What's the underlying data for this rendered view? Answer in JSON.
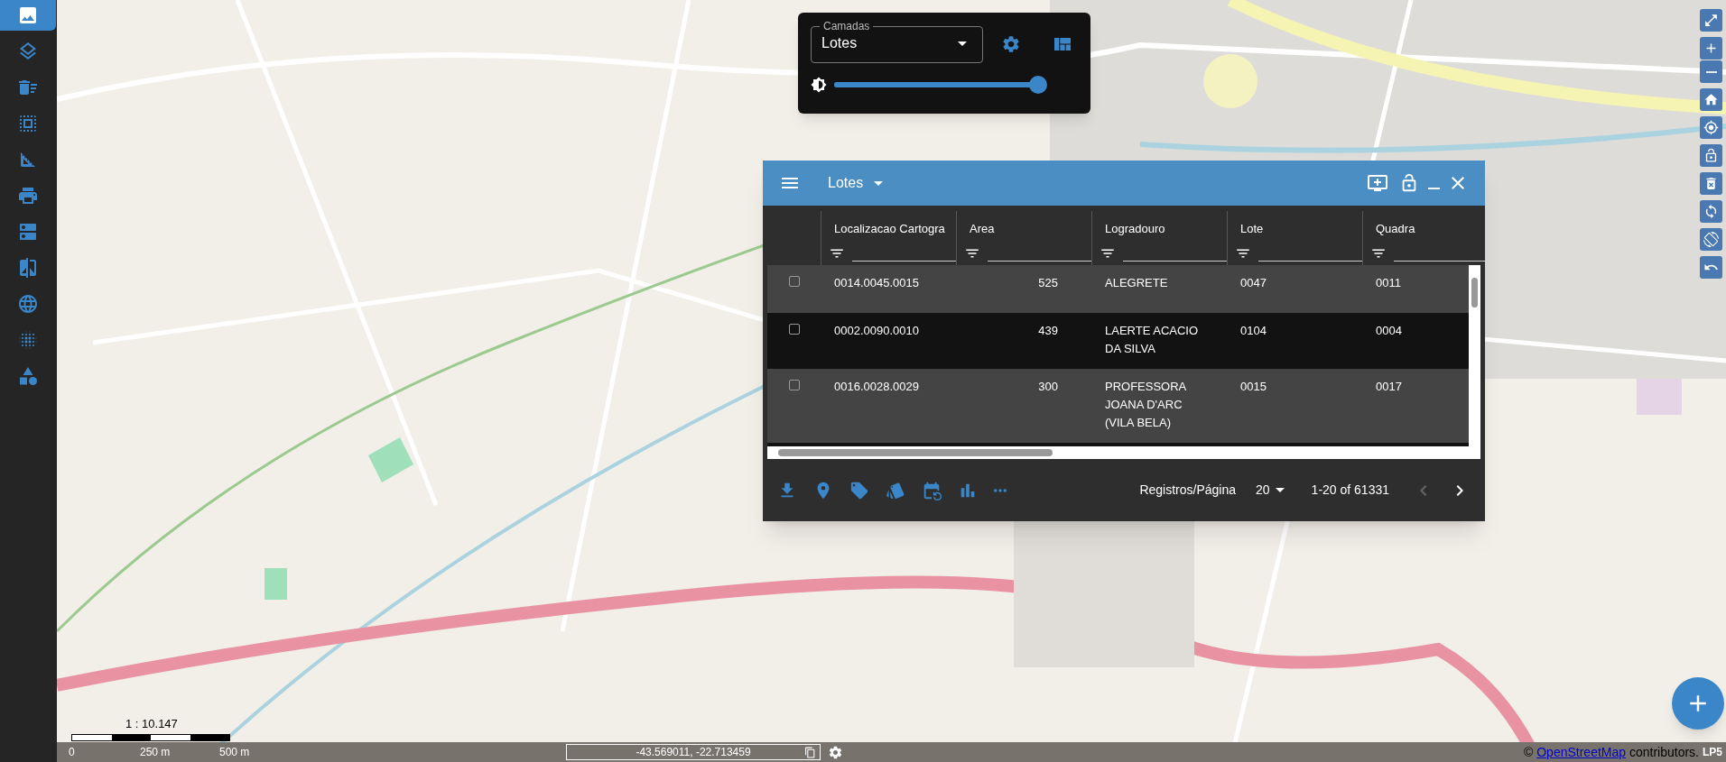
{
  "sidebar": {
    "items": [
      {
        "selected": true
      },
      {
        "selected": false
      },
      {
        "selected": false
      },
      {
        "selected": false
      },
      {
        "selected": false
      },
      {
        "selected": false
      },
      {
        "selected": false
      },
      {
        "selected": false
      },
      {
        "selected": false
      },
      {
        "selected": false
      },
      {
        "selected": false
      }
    ]
  },
  "layer_panel": {
    "label": "Camadas",
    "value": "Lotes",
    "opacity": {
      "level": 1
    }
  },
  "table_window": {
    "title": "Lotes",
    "columns": [
      {
        "label": "Localizacao Cartogra"
      },
      {
        "label": "Area"
      },
      {
        "label": "Logradouro"
      },
      {
        "label": "Lote"
      },
      {
        "label": "Quadra"
      }
    ],
    "rows": [
      {
        "checked": false,
        "cells": [
          "0014.0045.0015",
          "525",
          "ALEGRETE",
          "0047",
          "0011"
        ]
      },
      {
        "checked": false,
        "cells": [
          "0002.0090.0010",
          "439",
          "LAERTE ACACIO DA SILVA",
          "0104",
          "0004"
        ]
      },
      {
        "checked": false,
        "cells": [
          "0016.0028.0029",
          "300",
          "PROFESSORA JOANA D'ARC (VILA BELA)",
          "0015",
          "0017"
        ]
      }
    ],
    "pagination": {
      "label": "Registros/Página",
      "page_size": "20",
      "range": "1-20 of 61331",
      "previous_disabled": true,
      "next_disabled": false
    }
  },
  "map": {
    "kind": "picture",
    "scale": "1 : 10.147",
    "scale_labels": [
      "0",
      "250 m",
      "500 m"
    ],
    "coordinates": "-43.569011, -22.713459",
    "attribution_prefix": "©",
    "attribution_link": "OpenStreetMap",
    "attribution_suffix": "contributors.",
    "badge": "LP5"
  }
}
